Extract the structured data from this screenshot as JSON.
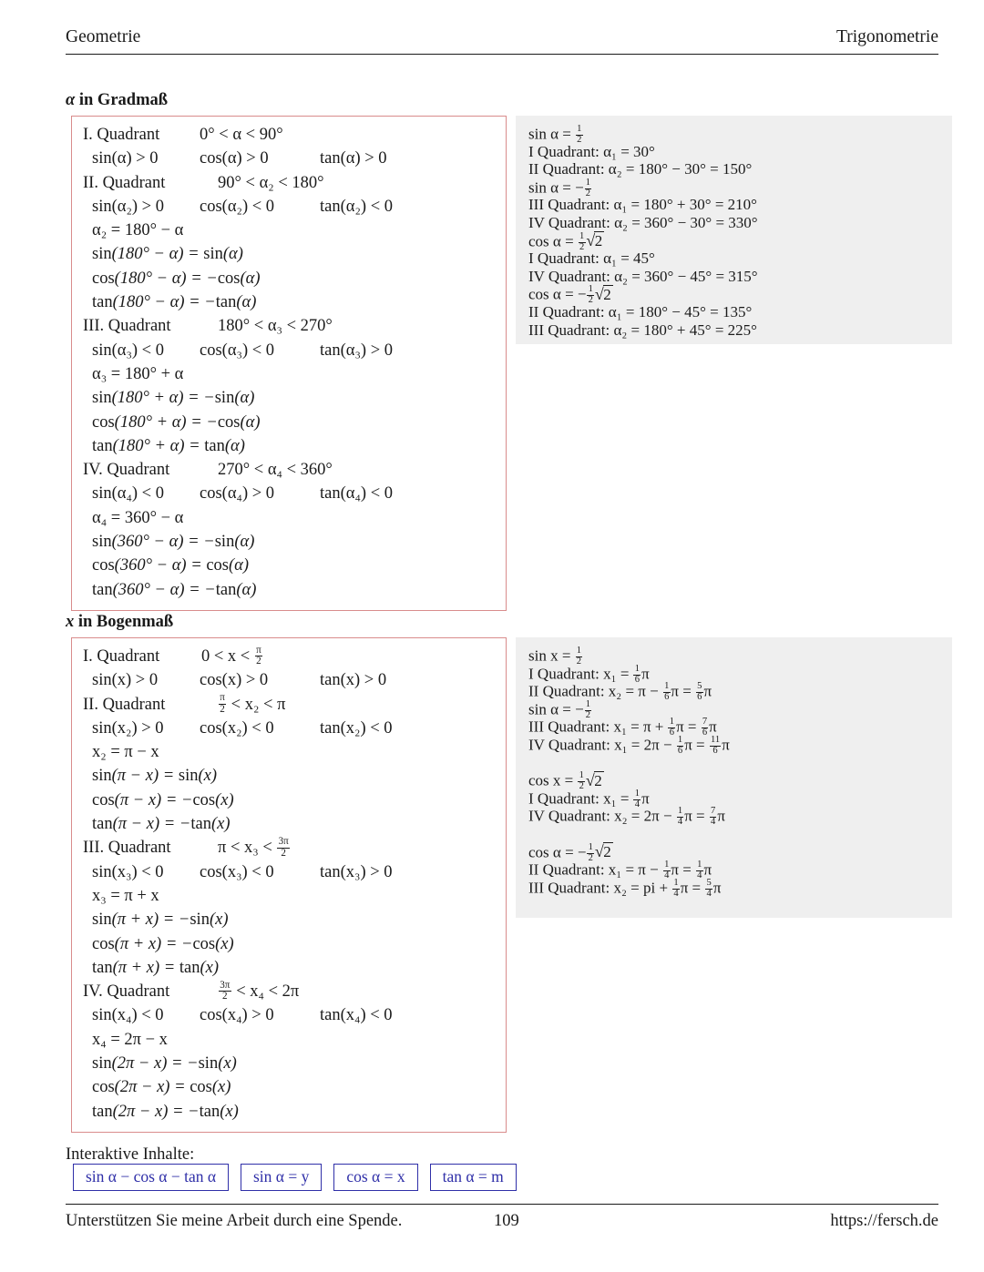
{
  "header": {
    "left": "Geometrie",
    "right": "Trigonometrie"
  },
  "sections": {
    "degrees": {
      "title_var": "α",
      "title_rest": " in Gradmaß"
    },
    "radians": {
      "title_var": "x",
      "title_rest": " in Bogenmaß"
    }
  },
  "degree_box": {
    "quadrants": [
      {
        "label": "I. Quadrant",
        "range": "0° < α < 90°",
        "signs": [
          "sin(α) > 0",
          "cos(α) > 0",
          "tan(α) > 0"
        ],
        "formulas": []
      },
      {
        "label": "II. Quadrant",
        "range": "90° < α₂ < 180°",
        "signs": [
          "sin(α₂) > 0",
          "cos(α₂) < 0",
          "tan(α₂) < 0"
        ],
        "formulas": [
          "α₂ = 180° − α",
          "sin(180° − α) = sin(α)",
          "cos(180° − α) = −cos(α)",
          "tan(180° − α) = −tan(α)"
        ]
      },
      {
        "label": "III. Quadrant",
        "range": "180° < α₃ < 270°",
        "signs": [
          "sin(α₃) < 0",
          "cos(α₃) < 0",
          "tan(α₃) > 0"
        ],
        "formulas": [
          "α₃ = 180° + α",
          "sin(180° + α) = −sin(α)",
          "cos(180° + α) = −cos(α)",
          "tan(180° + α) = tan(α)"
        ]
      },
      {
        "label": "IV. Quadrant",
        "range": "270° < α₄ < 360°",
        "signs": [
          "sin(α₄) < 0",
          "cos(α₄) > 0",
          "tan(α₄) < 0"
        ],
        "formulas": [
          "α₄ = 360° − α",
          "sin(360° − α) = −sin(α)",
          "cos(360° − α) = cos(α)",
          "tan(360° − α) = −tan(α)"
        ]
      }
    ]
  },
  "degree_examples": [
    {
      "kind": "eq_frac",
      "lhs": "sin α =",
      "sign": "",
      "num": "1",
      "den": "2",
      "suffix": ""
    },
    {
      "kind": "text",
      "text": "I Quadrant: α₁ = 30°"
    },
    {
      "kind": "text",
      "text": "II Quadrant: α₂ = 180° − 30° = 150°"
    },
    {
      "kind": "eq_frac",
      "lhs": "sin α =",
      "sign": "−",
      "num": "1",
      "den": "2",
      "suffix": ""
    },
    {
      "kind": "text",
      "text": "III Quadrant: α₁ = 180° + 30° = 210°"
    },
    {
      "kind": "text",
      "text": "IV Quadrant: α₂ = 360° − 30° = 330°"
    },
    {
      "kind": "eq_frac_sqrt",
      "lhs": "cos α =",
      "sign": "",
      "num": "1",
      "den": "2",
      "radicand": "2"
    },
    {
      "kind": "text",
      "text": "I Quadrant: α₁ = 45°"
    },
    {
      "kind": "text",
      "text": "IV Quadrant: α₂ = 360° − 45° = 315°"
    },
    {
      "kind": "eq_frac_sqrt",
      "lhs": "cos α =",
      "sign": "−",
      "num": "1",
      "den": "2",
      "radicand": "2"
    },
    {
      "kind": "text",
      "text": "II Quadrant: α₁ = 180° − 45° = 135°"
    },
    {
      "kind": "text",
      "text": "III Quadrant: α₂ = 180° + 45° = 225°"
    }
  ],
  "radian_box": {
    "quadrants": [
      {
        "label": "I. Quadrant",
        "range_pre": "0 < x <",
        "range_frac": {
          "num": "π",
          "den": "2"
        },
        "range_post": "",
        "signs": [
          "sin(x) > 0",
          "cos(x) > 0",
          "tan(x) > 0"
        ],
        "formulas": []
      },
      {
        "label": "II. Quadrant",
        "range_pre": "",
        "range_frac": {
          "num": "π",
          "den": "2"
        },
        "range_post": "< x₂ < π",
        "signs": [
          "sin(x₂) > 0",
          "cos(x₂) < 0",
          "tan(x₂) < 0"
        ],
        "formulas": [
          "x₂ = π − x",
          "sin(π − x) = sin(x)",
          "cos(π − x) = −cos(x)",
          "tan(π − x) = −tan(x)"
        ]
      },
      {
        "label": "III. Quadrant",
        "range_pre": "π < x₃ <",
        "range_frac": {
          "num": "3π",
          "den": "2"
        },
        "range_post": "",
        "signs": [
          "sin(x₃) < 0",
          "cos(x₃) < 0",
          "tan(x₃) > 0"
        ],
        "formulas": [
          "x₃ = π + x",
          "sin(π + x) = −sin(x)",
          "cos(π + x) = −cos(x)",
          "tan(π + x) = tan(x)"
        ]
      },
      {
        "label": "IV. Quadrant",
        "range_pre": "",
        "range_frac": {
          "num": "3π",
          "den": "2"
        },
        "range_post": "< x₄ < 2π",
        "signs": [
          "sin(x₄) < 0",
          "cos(x₄) > 0",
          "tan(x₄) < 0"
        ],
        "formulas": [
          "x₄ = 2π − x",
          "sin(2π − x) = −sin(x)",
          "cos(2π − x) = cos(x)",
          "tan(2π − x) = −tan(x)"
        ]
      }
    ]
  },
  "radian_examples": [
    {
      "kind": "eq_frac",
      "lhs": "sin x =",
      "sign": "",
      "num": "1",
      "den": "2",
      "suffix": ""
    },
    {
      "kind": "pi_line",
      "prefix": "I Quadrant: x₁ =",
      "terms": [
        {
          "num": "1",
          "den": "6",
          "tail": "π"
        }
      ]
    },
    {
      "kind": "pi_line",
      "prefix": "II Quadrant: x₂ = π −",
      "terms": [
        {
          "num": "1",
          "den": "6",
          "tail": "π ="
        },
        {
          "num": "5",
          "den": "6",
          "tail": "π"
        }
      ]
    },
    {
      "kind": "eq_frac",
      "lhs": "sin α =",
      "sign": "−",
      "num": "1",
      "den": "2",
      "suffix": ""
    },
    {
      "kind": "pi_line",
      "prefix": "III Quadrant: x₁ = π +",
      "terms": [
        {
          "num": "1",
          "den": "6",
          "tail": "π ="
        },
        {
          "num": "7",
          "den": "6",
          "tail": "π"
        }
      ]
    },
    {
      "kind": "pi_line",
      "prefix": "IV Quadrant: x₁ = 2π −",
      "terms": [
        {
          "num": "1",
          "den": "6",
          "tail": "π ="
        },
        {
          "num": "11",
          "den": "6",
          "tail": "π"
        }
      ]
    },
    {
      "kind": "spacer"
    },
    {
      "kind": "eq_frac_sqrt",
      "lhs": "cos x =",
      "sign": "",
      "num": "1",
      "den": "2",
      "radicand": "2"
    },
    {
      "kind": "pi_line",
      "prefix": "I Quadrant: x₁ =",
      "terms": [
        {
          "num": "1",
          "den": "4",
          "tail": "π"
        }
      ]
    },
    {
      "kind": "pi_line",
      "prefix": "IV Quadrant: x₂ = 2π −",
      "terms": [
        {
          "num": "1",
          "den": "4",
          "tail": "π ="
        },
        {
          "num": "7",
          "den": "4",
          "tail": "π"
        }
      ]
    },
    {
      "kind": "spacer"
    },
    {
      "kind": "eq_frac_sqrt",
      "lhs": "cos α =",
      "sign": "−",
      "num": "1",
      "den": "2",
      "radicand": "2"
    },
    {
      "kind": "pi_line",
      "prefix": "II Quadrant: x₁ = π −",
      "terms": [
        {
          "num": "1",
          "den": "4",
          "tail": "π ="
        },
        {
          "num": "1",
          "den": "4",
          "tail": "π"
        }
      ]
    },
    {
      "kind": "pi_line",
      "prefix": "III Quadrant: x₂ = pi +",
      "terms": [
        {
          "num": "1",
          "den": "4",
          "tail": "π ="
        },
        {
          "num": "5",
          "den": "4",
          "tail": "π"
        }
      ]
    }
  ],
  "interactive": {
    "label": "Interaktive Inhalte:",
    "links": [
      "sin α − cos α − tan α",
      "sin α = y",
      "cos α = x",
      "tan α = m"
    ]
  },
  "footer": {
    "left": "Unterstützen Sie meine Arbeit durch eine Spende.",
    "page": "109",
    "right": "https://fersch.de"
  },
  "colors": {
    "box_border": "#d98c8c",
    "panel_bg": "#efefef",
    "link_blue": "#2f2fa8",
    "text": "#1a1a1a"
  }
}
